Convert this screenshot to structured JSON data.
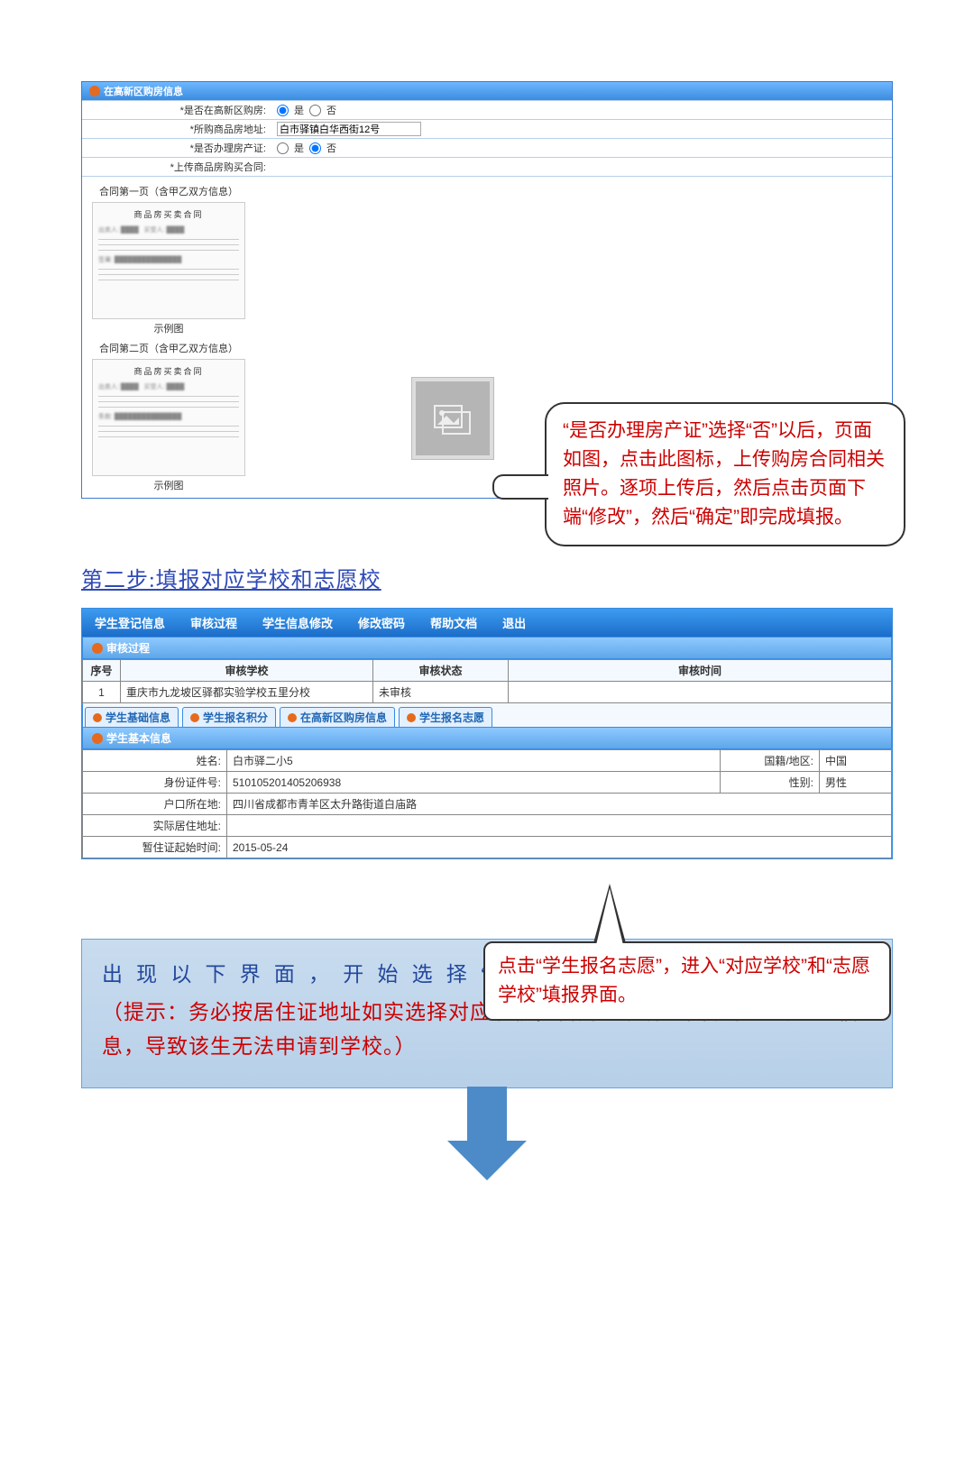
{
  "section1": {
    "header": "在高新区购房信息",
    "rows": {
      "row1_label": "*是否在高新区购房:",
      "row1_opt1": "是",
      "row1_opt2": "否",
      "row2_label": "*所购商品房地址:",
      "row2_value": "白市驿镇白华西街12号",
      "row3_label": "*是否办理房产证:",
      "row3_opt1": "是",
      "row3_opt2": "否",
      "row4_label": "*上传商品房购买合同:"
    },
    "samples": {
      "cap1a": "合同第一页（含甲乙双方信息）",
      "cap1b": "商品房买卖合同",
      "tag": "示例图",
      "cap2a": "合同第二页（含甲乙双方信息）",
      "cap2b": "商品房买卖合同"
    }
  },
  "callout1": "“是否办理房产证”选择“否”以后，页面如图，点击此图标，上传购房合同相关照片。逐项上传后，然后点击页面下端“修改”，然后“确定”即完成填报。",
  "step2_title": "第二步:填报对应学校和志愿校",
  "section2": {
    "nav": [
      "学生登记信息",
      "审核过程",
      "学生信息修改",
      "修改密码",
      "帮助文档",
      "退出"
    ],
    "sub_header": "审核过程",
    "audit": {
      "heads": [
        "序号",
        "审核学校",
        "审核状态",
        "审核时间"
      ],
      "row": {
        "seq": "1",
        "school": "重庆市九龙坡区驿都实验学校五里分校",
        "status": "未审核",
        "time": ""
      }
    },
    "tabs": [
      "学生基础信息",
      "学生报名积分",
      "在高新区购房信息",
      "学生报名志愿"
    ],
    "info_header": "学生基本信息",
    "info": {
      "name_l": "姓名:",
      "name": "白市驿二小5",
      "nat_l": "国籍/地区:",
      "nat": "中国",
      "id_l": "身份证件号:",
      "id": "510105201405206938",
      "sex_l": "性别:",
      "sex": "男性",
      "hk_l": "户口所在地:",
      "hk": "四川省成都市青羊区太升路街道白庙路",
      "live_l": "实际居住地址:",
      "live": "",
      "tmp_l": "暂住证起始时间:",
      "tmp": "2015-05-24"
    }
  },
  "callout2": "点击“学生报名志愿”，进入“对应学校”和“志愿学校”填报界面。",
  "banner": {
    "line1": "出现以下界面，开始选择“对应学校”和“志愿学校”",
    "line2": "（提示：务必按居住证地址如实选择对应学校，否则系统将退回该学生的登记信息，导致该生无法申请到学校。）"
  }
}
